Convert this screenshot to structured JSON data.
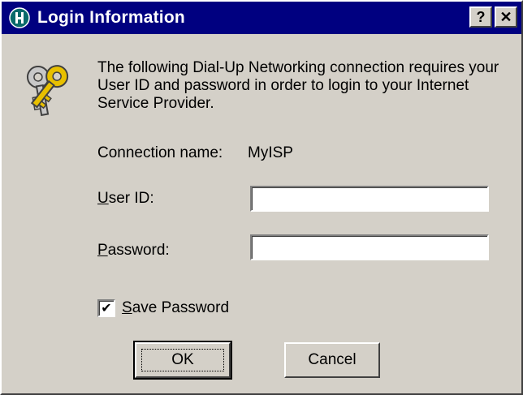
{
  "window": {
    "title": "Login Information",
    "help_button": "?",
    "close_button": "✕"
  },
  "message": "The following Dial-Up Networking connection requires your User ID and password in order to login to your Internet Service Provider.",
  "connection": {
    "label": "Connection name:",
    "value": "MyISP"
  },
  "user_id": {
    "label_mnemonic": "U",
    "label_rest": "ser ID:",
    "value": ""
  },
  "password": {
    "label_mnemonic": "P",
    "label_rest": "assword:",
    "value": ""
  },
  "save_password": {
    "label_mnemonic": "S",
    "label_rest": "ave Password",
    "checked": true,
    "check_glyph": "✔"
  },
  "buttons": {
    "ok": "OK",
    "cancel": "Cancel"
  },
  "icons": {
    "title": "network-icon",
    "main": "keys-icon"
  },
  "colors": {
    "titlebar": "#000080",
    "face": "#d4d0c8",
    "key_gold": "#e8c000"
  }
}
